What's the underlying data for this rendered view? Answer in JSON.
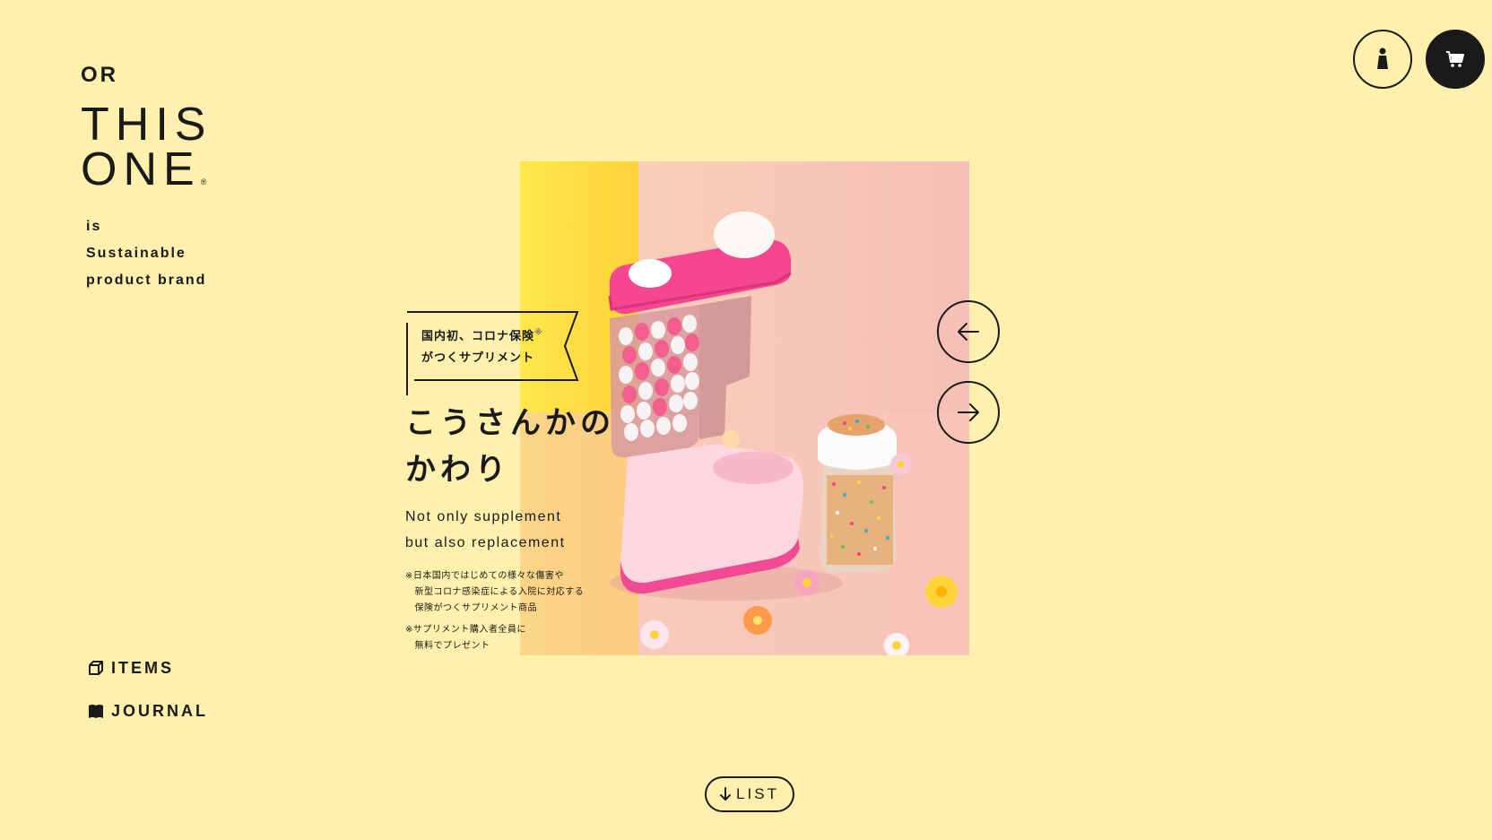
{
  "brand": {
    "prefix": "OR",
    "line1": "THIS",
    "line2": "ONE",
    "registered": "®",
    "tagline": [
      "is",
      "Sustainable",
      "product brand"
    ]
  },
  "nav": {
    "items": [
      {
        "label": "ITEMS",
        "icon": "box-icon"
      },
      {
        "label": "JOURNAL",
        "icon": "book-icon"
      }
    ]
  },
  "header": {
    "account_icon": "person-icon",
    "cart_icon": "cart-icon"
  },
  "slide": {
    "banner_line1": "国内初、コロナ保険",
    "banner_mark": "※",
    "banner_line2": "がつくサプリメント",
    "catch_line1": "こうさんかの",
    "catch_line2": "かわり",
    "eng_line1": "Not only supplement",
    "eng_line2": "but also replacement",
    "note1": "※日本国内ではじめての様々な傷害や\n　新型コロナ感染症による入院に対応する\n　保険がつくサプリメント商品",
    "note2": "※サプリメント購入者全員に\n　無料でプレゼント"
  },
  "controls": {
    "prev_icon": "arrow-left-icon",
    "next_icon": "arrow-right-icon",
    "list_label": "LIST",
    "list_icon": "arrow-down-icon"
  },
  "colors": {
    "background": "#fff0ad",
    "ink": "#1a1a1a",
    "accent_pink": "#f0428c",
    "accent_yellow": "#ffe033"
  }
}
